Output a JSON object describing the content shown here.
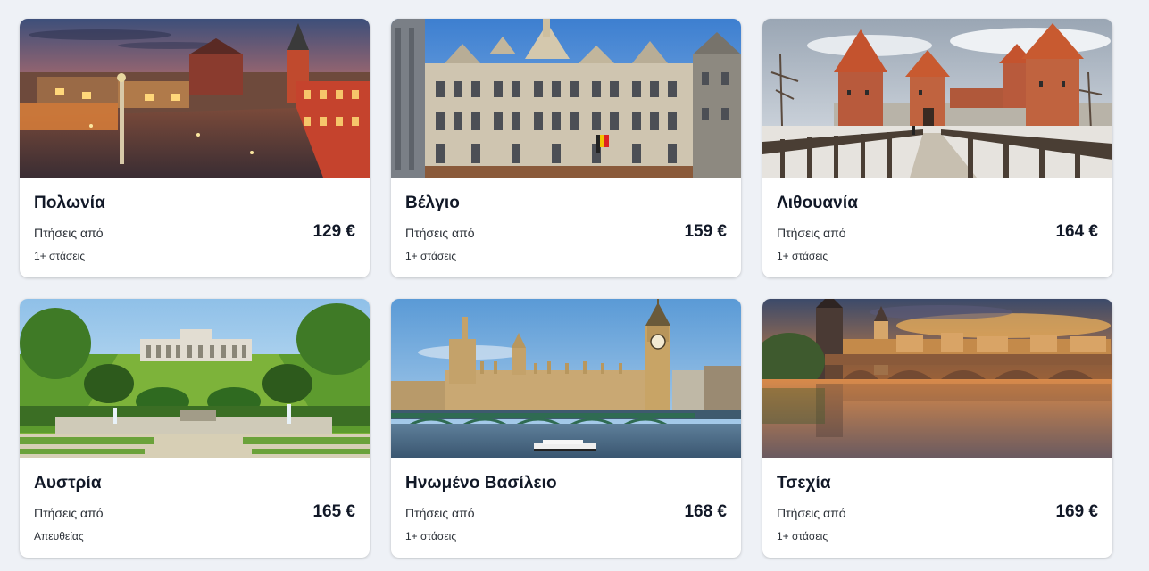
{
  "destinations": [
    {
      "country": "Πολωνία",
      "from_label": "Πτήσεις από",
      "price": "129 €",
      "stops": "1+ στάσεις"
    },
    {
      "country": "Βέλγιο",
      "from_label": "Πτήσεις από",
      "price": "159 €",
      "stops": "1+ στάσεις"
    },
    {
      "country": "Λιθουανία",
      "from_label": "Πτήσεις από",
      "price": "164 €",
      "stops": "1+ στάσεις"
    },
    {
      "country": "Αυστρία",
      "from_label": "Πτήσεις από",
      "price": "165 €",
      "stops": "Απευθείας"
    },
    {
      "country": "Ηνωμένο Βασίλειο",
      "from_label": "Πτήσεις από",
      "price": "168 €",
      "stops": "1+ στάσεις"
    },
    {
      "country": "Τσεχία",
      "from_label": "Πτήσεις από",
      "price": "169 €",
      "stops": "1+ στάσεις"
    }
  ]
}
